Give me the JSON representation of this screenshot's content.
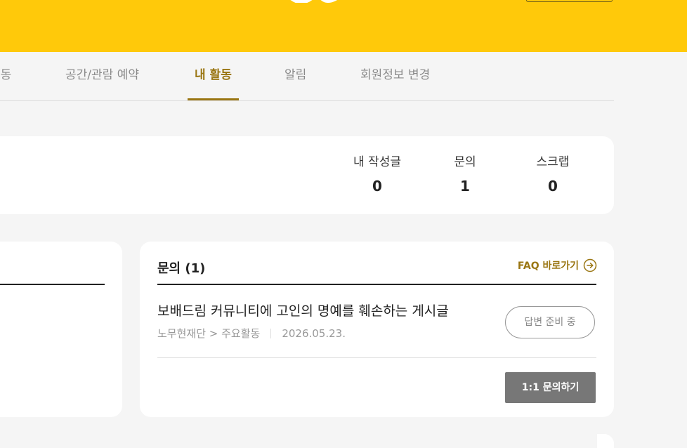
{
  "nav": {
    "tabs": [
      {
        "label": "활동"
      },
      {
        "label": "공간/관람 예약"
      },
      {
        "label": "내 활동",
        "active": true
      },
      {
        "label": "알림"
      },
      {
        "label": "회원정보 변경"
      }
    ]
  },
  "stats": [
    {
      "label": "내 작성글",
      "value": "0"
    },
    {
      "label": "문의",
      "value": "1"
    },
    {
      "label": "스크랩",
      "value": "0"
    }
  ],
  "inquiry": {
    "title": "문의 (1)",
    "faq_link": "FAQ 바로가기",
    "item": {
      "title": "보배드림 커뮤니티에 고인의 명예를 훼손하는 게시글",
      "category": "노무현재단 > 주요활동",
      "date": "2026.05.23.",
      "status": "답변 준비 중"
    },
    "ask_button": "1:1 문의하기"
  },
  "colors": {
    "brand_yellow": "#ffc90a",
    "accent_gold": "#9a7613",
    "button_gray": "#777777"
  },
  "icons": {
    "faq": "arrow-right-circle-icon"
  }
}
